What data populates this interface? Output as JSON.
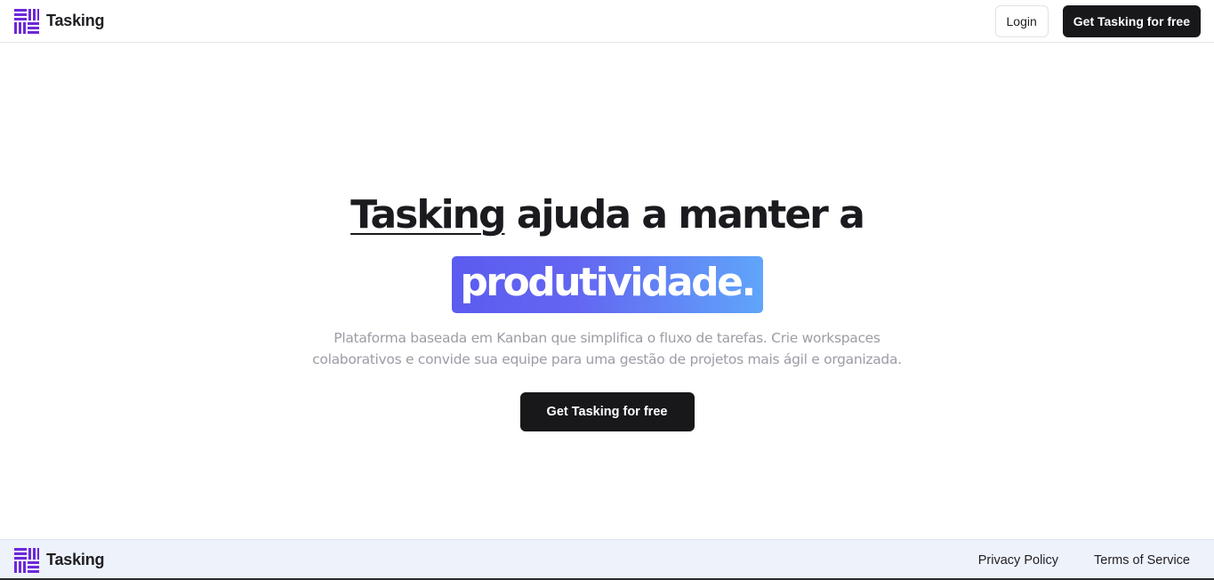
{
  "header": {
    "brand": "Tasking",
    "login_label": "Login",
    "cta_label": "Get Tasking for free"
  },
  "hero": {
    "title_brand": "Tasking",
    "title_rest": " ajuda a manter a",
    "highlight": "produtividade.",
    "description": "Plataforma baseada em Kanban que simplifica o fluxo de tarefas. Crie workspaces colaborativos e convide sua equipe para uma gestão de projetos mais ágil e organizada.",
    "cta_label": "Get Tasking for free"
  },
  "footer": {
    "brand": "Tasking",
    "links": [
      "Privacy Policy",
      "Terms of Service"
    ]
  },
  "colors": {
    "brand_purple": "#6d28d9",
    "dark_button": "#18181b",
    "gradient_start": "#6366f1",
    "gradient_end": "#60a5fa",
    "footer_bg": "#eef2fb"
  },
  "icons": {
    "logo": "tasking-logo-icon"
  }
}
